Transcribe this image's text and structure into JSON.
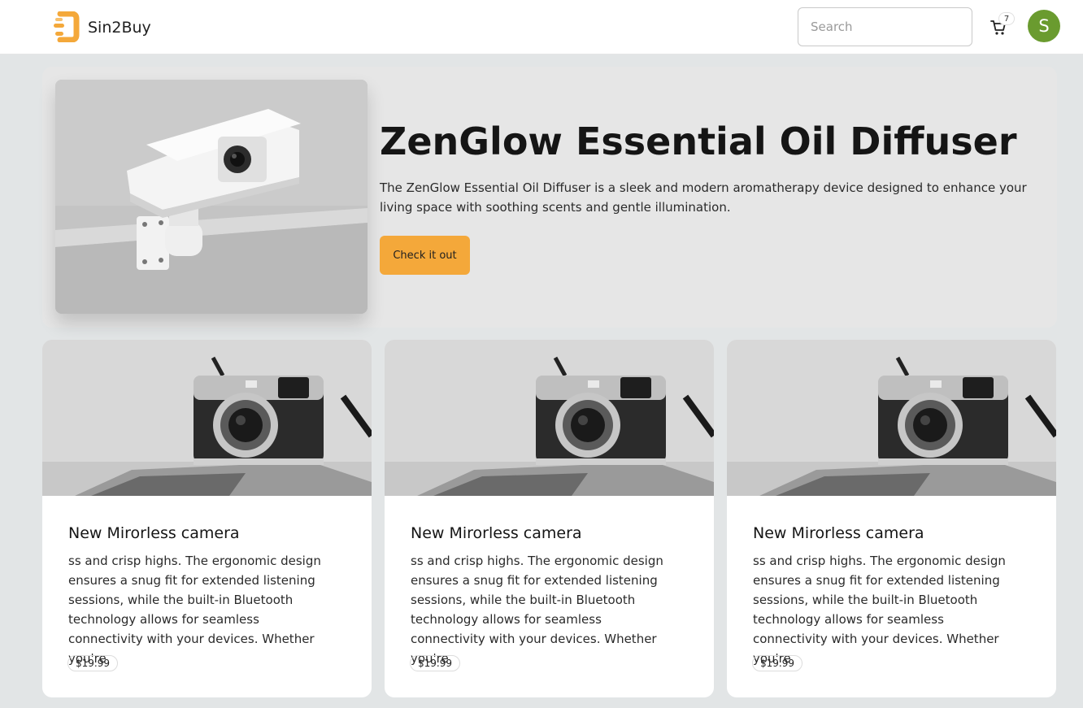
{
  "header": {
    "brand": "Sin2Buy",
    "search_placeholder": "Search",
    "cart_count": "7",
    "avatar_initial": "S",
    "colors": {
      "logo": "#f4a83a",
      "avatar": "#6a9b2f"
    }
  },
  "hero": {
    "title": "ZenGlow Essential Oil Diffuser",
    "description": "The ZenGlow Essential Oil Diffuser is a sleek and modern aromatherapy device designed to enhance your living space with soothing scents and gentle illumination.",
    "button_label": "Check it out",
    "image": "security-camera",
    "button_color": "#f4a83a"
  },
  "products": [
    {
      "title": "New Mirorless camera",
      "description": "ss and crisp highs. The ergonomic design ensures a snug fit for extended listening sessions, while the built-in Bluetooth technology allows for seamless connectivity with your devices. Whether you're",
      "price": "$19.99",
      "image": "camera"
    },
    {
      "title": "New Mirorless camera",
      "description": "ss and crisp highs. The ergonomic design ensures a snug fit for extended listening sessions, while the built-in Bluetooth technology allows for seamless connectivity with your devices. Whether you're",
      "price": "$19.99",
      "image": "camera"
    },
    {
      "title": "New Mirorless camera",
      "description": "ss and crisp highs. The ergonomic design ensures a snug fit for extended listening sessions, while the built-in Bluetooth technology allows for seamless connectivity with your devices. Whether you're",
      "price": "$19.99",
      "image": "camera"
    }
  ]
}
